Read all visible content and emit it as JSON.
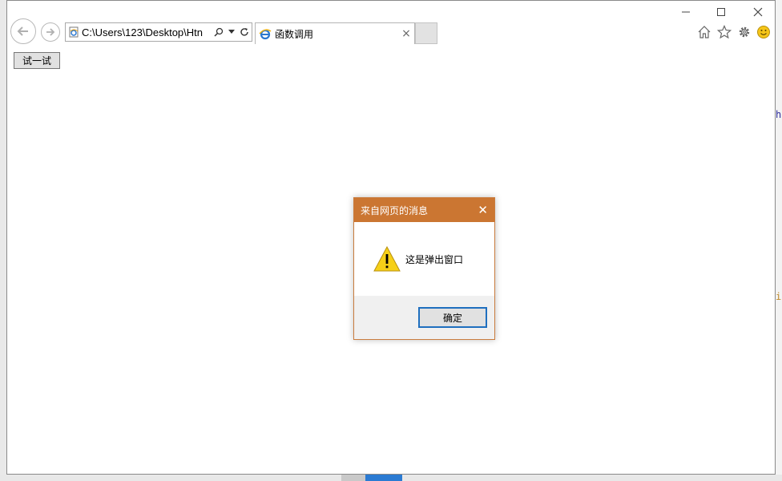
{
  "browser": {
    "address": "C:\\Users\\123\\Desktop\\Htn",
    "tab_title": "函数调用",
    "tab_close": "×"
  },
  "page": {
    "button_label": "试一试"
  },
  "dialog": {
    "title": "来自网页的消息",
    "close": "✕",
    "message": "这是弹出窗口",
    "ok_label": "确定"
  },
  "background": {
    "right_char_1": "h",
    "right_char_2": "i"
  },
  "colors": {
    "dialog_title_bg": "#cb7632",
    "ok_border": "#1f6fbf"
  }
}
